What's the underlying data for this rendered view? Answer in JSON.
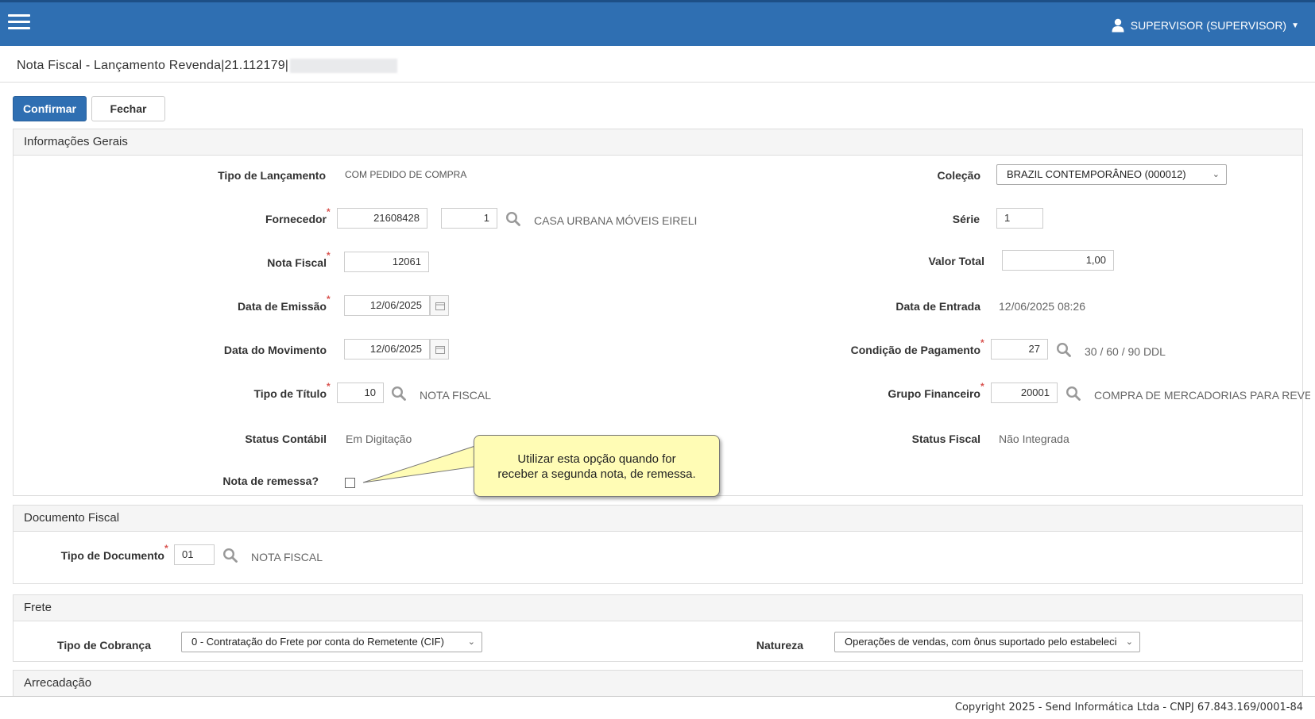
{
  "header": {
    "user_label": "SUPERVISOR (SUPERVISOR)"
  },
  "page": {
    "title": "Nota Fiscal - Lançamento Revenda|21.112179|"
  },
  "toolbar": {
    "confirm_label": "Confirmar",
    "close_label": "Fechar"
  },
  "informacoes_gerais": {
    "heading": "Informações Gerais",
    "tipo_lancamento": {
      "label": "Tipo de Lançamento",
      "value": "COM PEDIDO DE COMPRA"
    },
    "colecao": {
      "label": "Coleção",
      "value": "BRAZIL CONTEMPORÂNEO (000012)"
    },
    "fornecedor": {
      "label": "Fornecedor",
      "code": "21608428",
      "seq": "1",
      "name": "CASA URBANA MÓVEIS EIRELI"
    },
    "serie": {
      "label": "Série",
      "value": "1"
    },
    "nota_fiscal": {
      "label": "Nota Fiscal",
      "value": "12061"
    },
    "valor_total": {
      "label": "Valor Total",
      "value": "1,00"
    },
    "data_emissao": {
      "label": "Data de Emissão",
      "value": "12/06/2025"
    },
    "data_entrada": {
      "label": "Data de Entrada",
      "value": "12/06/2025 08:26"
    },
    "data_movimento": {
      "label": "Data do Movimento",
      "value": "12/06/2025"
    },
    "condicao_pagamento": {
      "label": "Condição de Pagamento",
      "code": "27",
      "desc": "30 / 60 / 90 DDL"
    },
    "tipo_titulo": {
      "label": "Tipo de Título",
      "code": "10",
      "desc": "NOTA FISCAL"
    },
    "grupo_financeiro": {
      "label": "Grupo Financeiro",
      "code": "20001",
      "desc": "COMPRA DE MERCADORIAS PARA REVENDA"
    },
    "status_contabil": {
      "label": "Status Contábil",
      "value": "Em Digitação"
    },
    "status_fiscal": {
      "label": "Status Fiscal",
      "value": "Não Integrada"
    },
    "nota_remessa": {
      "label": "Nota de remessa?",
      "checked": false
    }
  },
  "tooltip": {
    "line1": "Utilizar esta opção quando for",
    "line2": "receber a segunda nota, de remessa."
  },
  "documento_fiscal": {
    "heading": "Documento Fiscal",
    "tipo_documento": {
      "label": "Tipo de Documento",
      "code": "01",
      "desc": "NOTA FISCAL"
    }
  },
  "frete": {
    "heading": "Frete",
    "tipo_cobranca": {
      "label": "Tipo de Cobrança",
      "value": "0 - Contratação do Frete por conta do Remetente (CIF)"
    },
    "natureza": {
      "label": "Natureza",
      "value": "Operações de vendas, com ônus suportado pelo estabeleci"
    }
  },
  "arrecadacao": {
    "heading": "Arrecadação"
  },
  "footer": {
    "copyright": "Copyright 2025 - Send Informática Ltda - CNPJ 67.843.169/0001-84"
  },
  "colors": {
    "primary": "#2f6fb2",
    "required": "#d9534f",
    "tooltip_bg": "#fffcb5"
  }
}
